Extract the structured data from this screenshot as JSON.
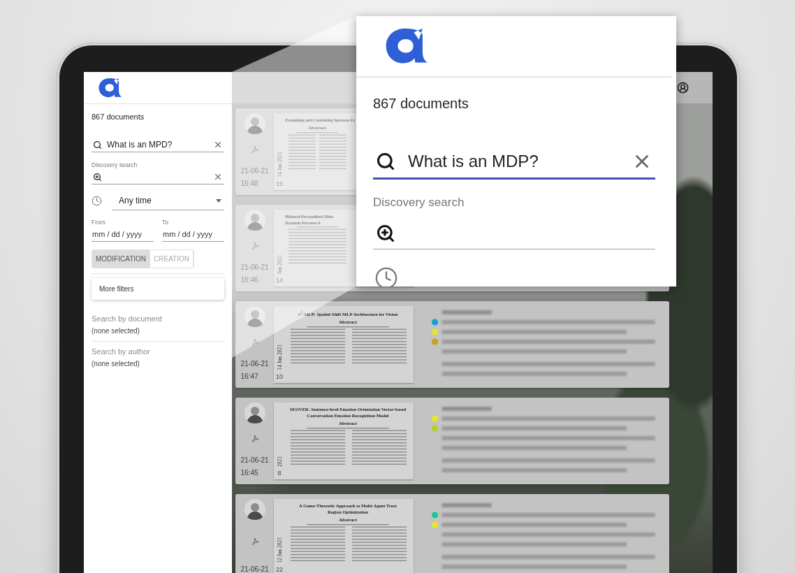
{
  "sidebar": {
    "document_count": "867 documents",
    "search": {
      "value": "What is an MPD?"
    },
    "discovery_search": {
      "label": "Discovery search"
    },
    "time_filter": {
      "value": "Any time"
    },
    "date_from": {
      "label": "From",
      "placeholder": "mm / dd / yyyy"
    },
    "date_to": {
      "label": "To",
      "placeholder": "mm / dd / yyyy"
    },
    "date_type": [
      {
        "label": "MODIFICATION",
        "selected": true
      },
      {
        "label": "CREATION",
        "selected": false
      }
    ],
    "more_filters": "More filters",
    "filters": [
      {
        "title": "Search by document",
        "value": "(none selected)"
      },
      {
        "title": "Search by author",
        "value": "(none selected)"
      }
    ]
  },
  "cards": [
    {
      "date": "21-06-21",
      "time": "16:48",
      "stamp": "14 Jun 2021",
      "page": "15",
      "title_lines": [
        "Examining and Combining Spurious Fe"
      ],
      "abstract_heading": "Abstract"
    },
    {
      "date": "21-06-21",
      "time": "16:46",
      "stamp": "Jun 2021",
      "page": "14",
      "title_lines": [
        "Bilateral Personalized Dialo",
        "Dynamic Persona-A"
      ]
    },
    {
      "date": "21-06-21",
      "time": "16:47",
      "stamp": "14 Jun 2021",
      "page": "10",
      "title_lines": [
        "S$^{2}$-MLP: Spatial-Shift MLP Architecture for Vision"
      ],
      "abstract_heading": "Abstract",
      "markers": [
        {
          "color": "#1aa0c8"
        },
        {
          "color": "#e6e62a"
        },
        {
          "color": "#c8a010"
        }
      ]
    },
    {
      "date": "21-06-21",
      "time": "16:45",
      "stamp": "2021",
      "page": "8",
      "title_lines": [
        "SEOVER: Sentence-level Emotion Orientation Vector based",
        "Conversation Emotion Recognition Model"
      ],
      "abstract_heading": "Abstract",
      "markers": [
        {
          "color": "#e6e62a"
        },
        {
          "color": "#b8d020"
        }
      ]
    },
    {
      "date": "21-06-21",
      "stamp": "12 Jun 2021",
      "page": "22",
      "title_lines": [
        "A Game-Theoretic Approach to Multi-Agent Trust",
        "Region Optimization"
      ],
      "abstract_heading": "Abstract",
      "markers": [
        {
          "color": "#18c890"
        },
        {
          "color": "#e6e62a"
        }
      ]
    }
  ],
  "callout": {
    "document_count": "867 documents",
    "search": {
      "value": "What is an MDP?",
      "focused": true
    },
    "discovery_search": {
      "label": "Discovery search"
    }
  }
}
